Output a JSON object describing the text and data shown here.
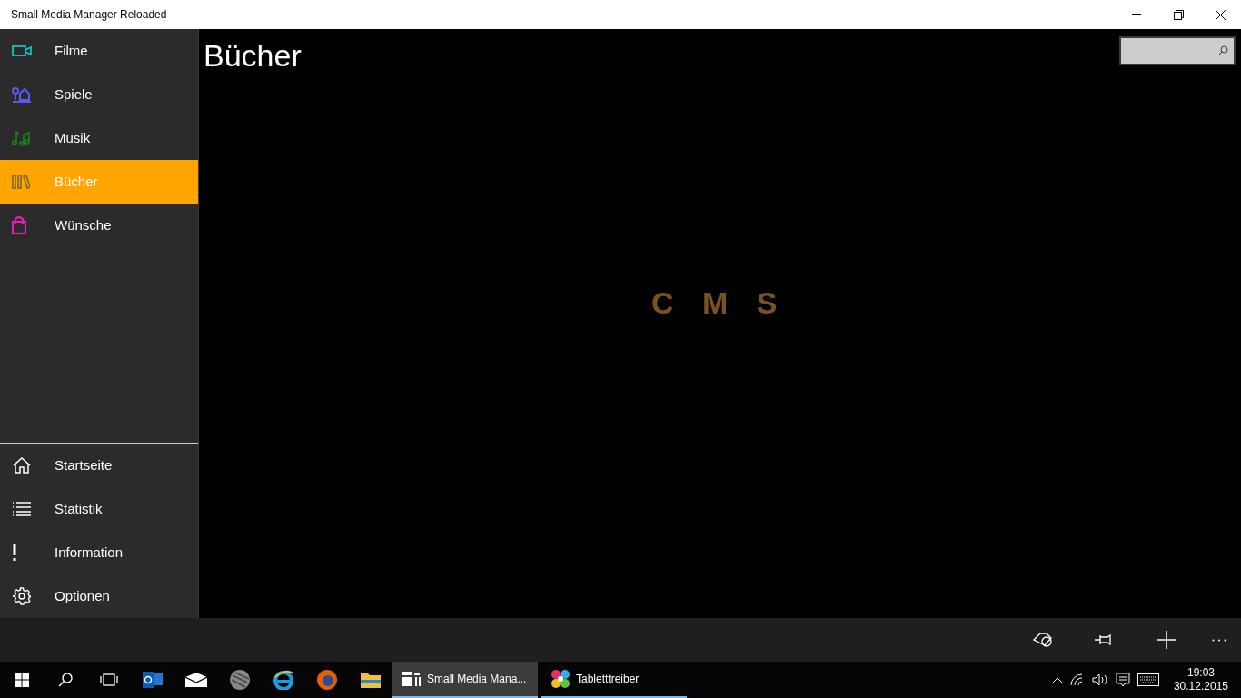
{
  "window": {
    "title": "Small Media Manager Reloaded"
  },
  "sidebar": {
    "items": [
      {
        "label": "Filme",
        "color": "#18c0c0",
        "selected": false
      },
      {
        "label": "Spiele",
        "color": "#5a5aee",
        "selected": false
      },
      {
        "label": "Musik",
        "color": "#148a14",
        "selected": false
      },
      {
        "label": "Bücher",
        "color": "#8a6a2a",
        "selected": true
      },
      {
        "label": "Wünsche",
        "color": "#e020b0",
        "selected": false
      }
    ],
    "footer_items": [
      {
        "label": "Startseite"
      },
      {
        "label": "Statistik"
      },
      {
        "label": "Information"
      },
      {
        "label": "Optionen"
      }
    ]
  },
  "page": {
    "title": "Bücher",
    "logo": "C M S"
  },
  "taskbar": {
    "apps": [
      {
        "label": "Small Media Mana...",
        "selected": true
      },
      {
        "label": "Tabletttreiber",
        "selected": false
      }
    ],
    "time": "19:03",
    "date": "30.12.2015"
  }
}
